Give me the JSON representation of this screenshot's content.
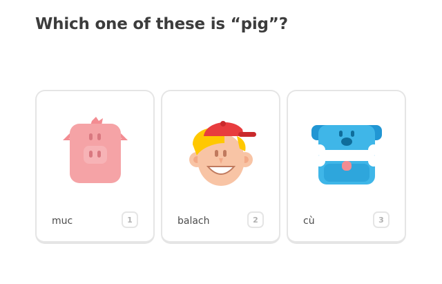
{
  "challenge": {
    "prompt": "Which one of these is “pig”?"
  },
  "choices": [
    {
      "word": "muc",
      "key": "1",
      "icon": "pig-icon"
    },
    {
      "word": "balach",
      "key": "2",
      "icon": "boy-icon"
    },
    {
      "word": "cù",
      "key": "3",
      "icon": "dog-icon"
    }
  ],
  "colors": {
    "text": "#3c3c3c",
    "border": "#e5e5e5",
    "key_text": "#afafaf",
    "pig": "#f5a3a6",
    "boy_cap": "#e83c3e",
    "boy_hair": "#ffc800",
    "dog": "#3fb6e8"
  }
}
